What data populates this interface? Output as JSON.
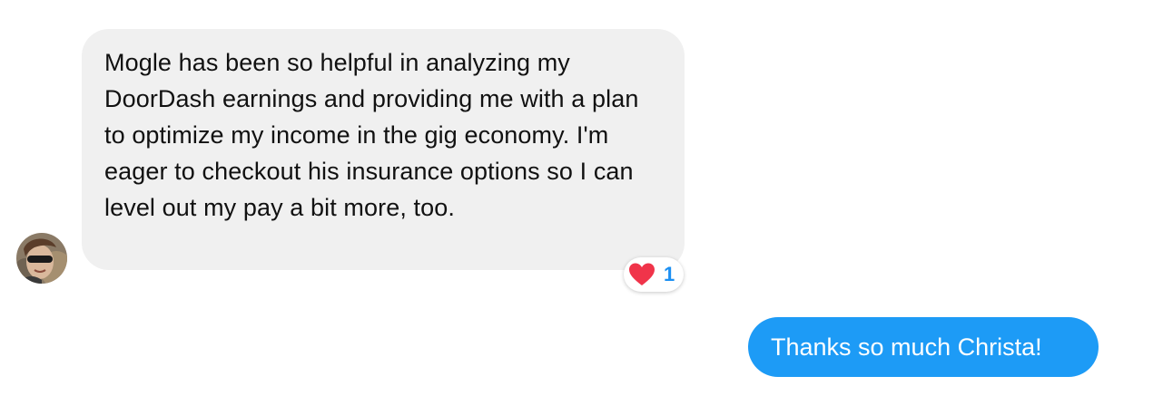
{
  "conversation": {
    "incoming": {
      "avatar_icon": "user-avatar-photo",
      "text": "Mogle has been so helpful in analyzing my DoorDash earnings and providing me with a plan to optimize my income in the gig economy. I'm eager to checkout his insurance options so I can level out my pay a bit more, too.",
      "bubble_color": "#f0f0f0",
      "reaction": {
        "icon": "heart-icon",
        "color": "#f0344a",
        "count": "1",
        "count_color": "#1b8ff2"
      }
    },
    "outgoing": {
      "text": "Thanks so much Christa!",
      "bubble_color": "#1d9bf6"
    }
  }
}
